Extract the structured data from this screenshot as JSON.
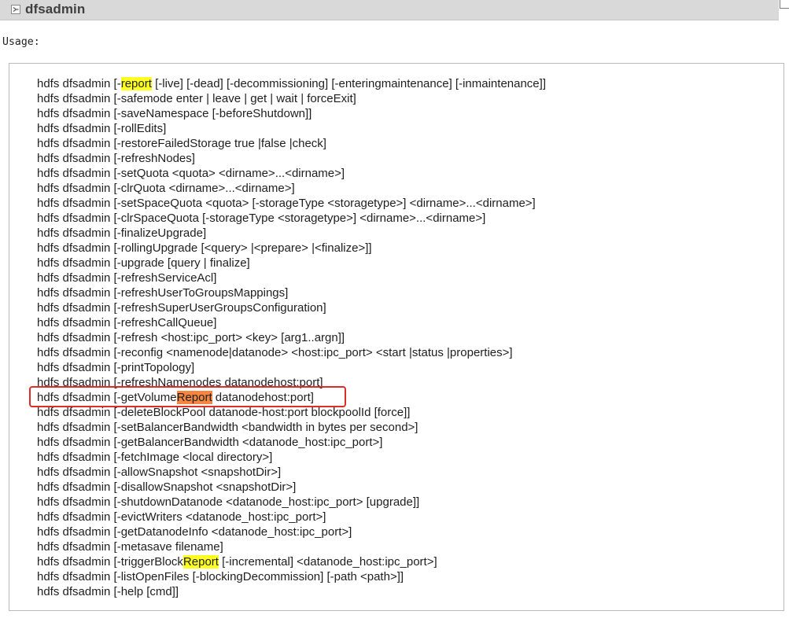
{
  "header": {
    "title": "dfsadmin",
    "toggle_icon": "collapse-toggle-icon"
  },
  "usage": {
    "label": "Usage:",
    "lines": [
      {
        "prefix": "hdfs dfsadmin [-",
        "highlight": "report",
        "highlight_type": "yellow",
        "suffix": " [-live] [-dead] [-decommissioning] [-enteringmaintenance] [-inmaintenance]]"
      },
      {
        "prefix": "hdfs dfsadmin [-safemode enter | leave | get | wait | forceExit]",
        "highlight": "",
        "highlight_type": "",
        "suffix": ""
      },
      {
        "prefix": "hdfs dfsadmin [-saveNamespace [-beforeShutdown]]",
        "highlight": "",
        "highlight_type": "",
        "suffix": ""
      },
      {
        "prefix": "hdfs dfsadmin [-rollEdits]",
        "highlight": "",
        "highlight_type": "",
        "suffix": ""
      },
      {
        "prefix": "hdfs dfsadmin [-restoreFailedStorage true |false |check]",
        "highlight": "",
        "highlight_type": "",
        "suffix": ""
      },
      {
        "prefix": "hdfs dfsadmin [-refreshNodes]",
        "highlight": "",
        "highlight_type": "",
        "suffix": ""
      },
      {
        "prefix": "hdfs dfsadmin [-setQuota <quota> <dirname>...<dirname>]",
        "highlight": "",
        "highlight_type": "",
        "suffix": ""
      },
      {
        "prefix": "hdfs dfsadmin [-clrQuota <dirname>...<dirname>]",
        "highlight": "",
        "highlight_type": "",
        "suffix": ""
      },
      {
        "prefix": "hdfs dfsadmin [-setSpaceQuota <quota> [-storageType <storagetype>] <dirname>...<dirname>]",
        "highlight": "",
        "highlight_type": "",
        "suffix": ""
      },
      {
        "prefix": "hdfs dfsadmin [-clrSpaceQuota [-storageType <storagetype>] <dirname>...<dirname>]",
        "highlight": "",
        "highlight_type": "",
        "suffix": ""
      },
      {
        "prefix": "hdfs dfsadmin [-finalizeUpgrade]",
        "highlight": "",
        "highlight_type": "",
        "suffix": ""
      },
      {
        "prefix": "hdfs dfsadmin [-rollingUpgrade [<query> |<prepare> |<finalize>]]",
        "highlight": "",
        "highlight_type": "",
        "suffix": ""
      },
      {
        "prefix": "hdfs dfsadmin [-upgrade [query | finalize]",
        "highlight": "",
        "highlight_type": "",
        "suffix": ""
      },
      {
        "prefix": "hdfs dfsadmin [-refreshServiceAcl]",
        "highlight": "",
        "highlight_type": "",
        "suffix": ""
      },
      {
        "prefix": "hdfs dfsadmin [-refreshUserToGroupsMappings]",
        "highlight": "",
        "highlight_type": "",
        "suffix": ""
      },
      {
        "prefix": "hdfs dfsadmin [-refreshSuperUserGroupsConfiguration]",
        "highlight": "",
        "highlight_type": "",
        "suffix": ""
      },
      {
        "prefix": "hdfs dfsadmin [-refreshCallQueue]",
        "highlight": "",
        "highlight_type": "",
        "suffix": ""
      },
      {
        "prefix": "hdfs dfsadmin [-refresh <host:ipc_port> <key> [arg1..argn]]",
        "highlight": "",
        "highlight_type": "",
        "suffix": ""
      },
      {
        "prefix": "hdfs dfsadmin [-reconfig <namenode|datanode> <host:ipc_port> <start |status |properties>]",
        "highlight": "",
        "highlight_type": "",
        "suffix": ""
      },
      {
        "prefix": "hdfs dfsadmin [-printTopology]",
        "highlight": "",
        "highlight_type": "",
        "suffix": ""
      },
      {
        "prefix": "hdfs dfsadmin [-refreshNamenodes datanodehost:port]",
        "highlight": "",
        "highlight_type": "",
        "suffix": ""
      },
      {
        "prefix": "hdfs dfsadmin [-getVolume",
        "highlight": "Report",
        "highlight_type": "orange",
        "suffix": " datanodehost:port]"
      },
      {
        "prefix": "hdfs dfsadmin [-deleteBlockPool datanode-host:port blockpoolId [force]]",
        "highlight": "",
        "highlight_type": "",
        "suffix": ""
      },
      {
        "prefix": "hdfs dfsadmin [-setBalancerBandwidth <bandwidth in bytes per second>]",
        "highlight": "",
        "highlight_type": "",
        "suffix": ""
      },
      {
        "prefix": "hdfs dfsadmin [-getBalancerBandwidth <datanode_host:ipc_port>]",
        "highlight": "",
        "highlight_type": "",
        "suffix": ""
      },
      {
        "prefix": "hdfs dfsadmin [-fetchImage <local directory>]",
        "highlight": "",
        "highlight_type": "",
        "suffix": ""
      },
      {
        "prefix": "hdfs dfsadmin [-allowSnapshot <snapshotDir>]",
        "highlight": "",
        "highlight_type": "",
        "suffix": ""
      },
      {
        "prefix": "hdfs dfsadmin [-disallowSnapshot <snapshotDir>]",
        "highlight": "",
        "highlight_type": "",
        "suffix": ""
      },
      {
        "prefix": "hdfs dfsadmin [-shutdownDatanode <datanode_host:ipc_port> [upgrade]]",
        "highlight": "",
        "highlight_type": "",
        "suffix": ""
      },
      {
        "prefix": "hdfs dfsadmin [-evictWriters <datanode_host:ipc_port>]",
        "highlight": "",
        "highlight_type": "",
        "suffix": ""
      },
      {
        "prefix": "hdfs dfsadmin [-getDatanodeInfo <datanode_host:ipc_port>]",
        "highlight": "",
        "highlight_type": "",
        "suffix": ""
      },
      {
        "prefix": "hdfs dfsadmin [-metasave filename]",
        "highlight": "",
        "highlight_type": "",
        "suffix": ""
      },
      {
        "prefix": "hdfs dfsadmin [-triggerBlock",
        "highlight": "Report",
        "highlight_type": "yellow",
        "suffix": " [-incremental] <datanode_host:ipc_port>]"
      },
      {
        "prefix": "hdfs dfsadmin [-listOpenFiles [-blockingDecommission] [-path <path>]]",
        "highlight": "",
        "highlight_type": "",
        "suffix": ""
      },
      {
        "prefix": "hdfs dfsadmin [-help [cmd]]",
        "highlight": "",
        "highlight_type": "",
        "suffix": ""
      }
    ]
  },
  "colors": {
    "header_bg": "#d9d9d9",
    "highlight_yellow": "#ffff21",
    "highlight_orange": "#f5853f",
    "annotation_frame": "#de2d26"
  }
}
